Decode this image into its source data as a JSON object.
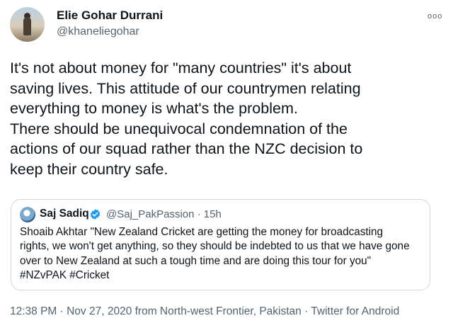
{
  "tweet": {
    "author": {
      "display_name": "Elie Gohar Durrani",
      "handle": "@khaneliegohar"
    },
    "more_icon": "ooo",
    "text": "It's not about money for \"many countries\" it's about\nsaving lives. This attitude of our countrymen relating\neverything to money is what's the problem.\nThere should be unequivocal condemnation of the\nactions of our squad rather than the NZC decision to\nkeep their country safe.",
    "quoted": {
      "display_name": "Saj Sadiq",
      "handle_time": "@Saj_PakPassion · 15h",
      "text": "Shoaib Akhtar \"New Zealand Cricket are getting the money for broadcasting\nrights, we won't get anything, so they should be indebted to us that we have gone\nover to New Zealand at such a tough time and are doing this tour for you\"\n#NZvPAK #Cricket",
      "verified_color": "#1d9bf0"
    },
    "meta": "12:38 PM · Nov 27, 2020 from North-west Frontier, Pakistan · Twitter for Android"
  }
}
